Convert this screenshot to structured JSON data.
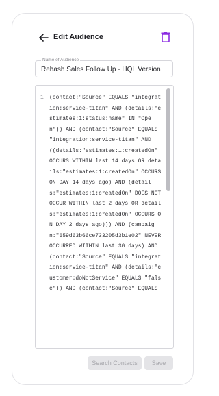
{
  "header": {
    "back_icon": "arrow-left-icon",
    "title": "Edit Audience",
    "delete_icon": "trash-icon",
    "accent_color": "#8b2be2"
  },
  "name_field": {
    "label": "Name of Audience",
    "value": "Rehash Sales Follow Up - HQL Version"
  },
  "editor": {
    "line_number": "1",
    "code": "(contact:\"Source\" EQUALS \"integration:service-titan\" AND (details:\"estimates:1:status:name\" IN \"Open\")) AND (contact:\"Source\" EQUALS \"integration:service-titan\" AND ((details:\"estimates:1:createdOn\" OCCURS WITHIN last 14 days OR details:\"estimates:1:createdOn\" OCCURS ON DAY 14 days ago) AND (details:\"estimates:1:createdOn\" DOES NOT OCCUR WITHIN last 2 days OR details:\"estimates:1:createdOn\" OCCURS ON DAY 2 days ago))) AND (campaign:\"659d63b66ce733205d3b1e02\" NEVER OCCURRED WITHIN last 30 days) AND (contact:\"Source\" EQUALS \"integration:service-titan\" AND (details:\"customer:doNotService\" EQUALS \"false\")) AND (contact:\"Source\" EQUALS"
  },
  "actions": {
    "search_label": "Search Contacts",
    "save_label": "Save"
  }
}
